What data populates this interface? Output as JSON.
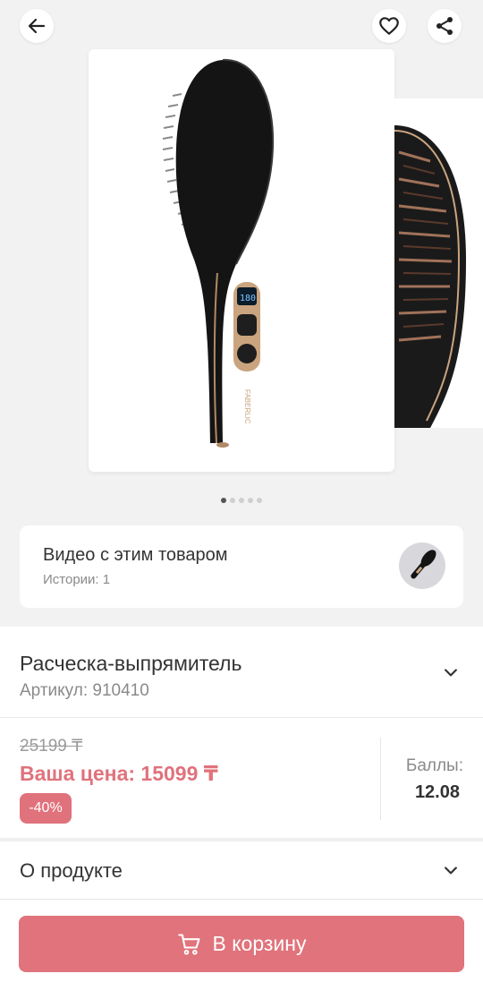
{
  "header": {
    "back_icon": "arrow-left-icon",
    "favorite_icon": "heart-icon",
    "share_icon": "share-icon"
  },
  "gallery": {
    "slide_count": 5,
    "active_index": 0,
    "main_image": "hair-straightening-brush-black",
    "next_image": "hair-straightening-brush-bristles-closeup"
  },
  "video_card": {
    "title": "Видео с этим товаром",
    "subtitle": "Истории: 1"
  },
  "product": {
    "title": "Расческа-выпрямитель",
    "sku": "Артикул: 910410"
  },
  "pricing": {
    "old_price": "25199 ₸",
    "your_price": "Ваша цена: 15099 ₸",
    "discount": "-40%",
    "points_label": "Баллы:",
    "points_value": "12.08"
  },
  "sections": {
    "about": "О продукте"
  },
  "cart": {
    "label": "В корзину"
  },
  "colors": {
    "accent": "#e0737b",
    "background": "#f2f2f2"
  }
}
